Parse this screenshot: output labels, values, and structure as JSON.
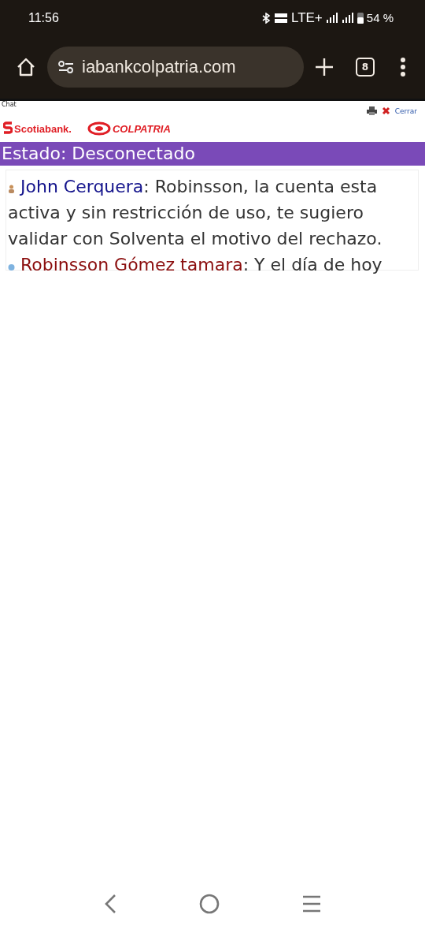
{
  "status_bar": {
    "time": "11:56",
    "network": "LTE+",
    "battery": "54 %"
  },
  "browser": {
    "url": "iabankcolpatria.com",
    "tab_count": "8"
  },
  "page": {
    "frame_title": "Chat",
    "close_link": "Cerrar",
    "logos": [
      "Scotiabank.",
      "COLPATRIA"
    ],
    "status": "Estado: Desconectado",
    "messages": [
      {
        "kind": "agent",
        "sender": "John Cerquera",
        "text": ": Robinsson, la cuenta esta activa y sin restricción de uso, te sugiero validar con Solventa el motivo del rechazo."
      },
      {
        "kind": "client",
        "sender": "Robinsson Gómez tamara",
        "text": ": Y el día de hoy"
      }
    ]
  }
}
